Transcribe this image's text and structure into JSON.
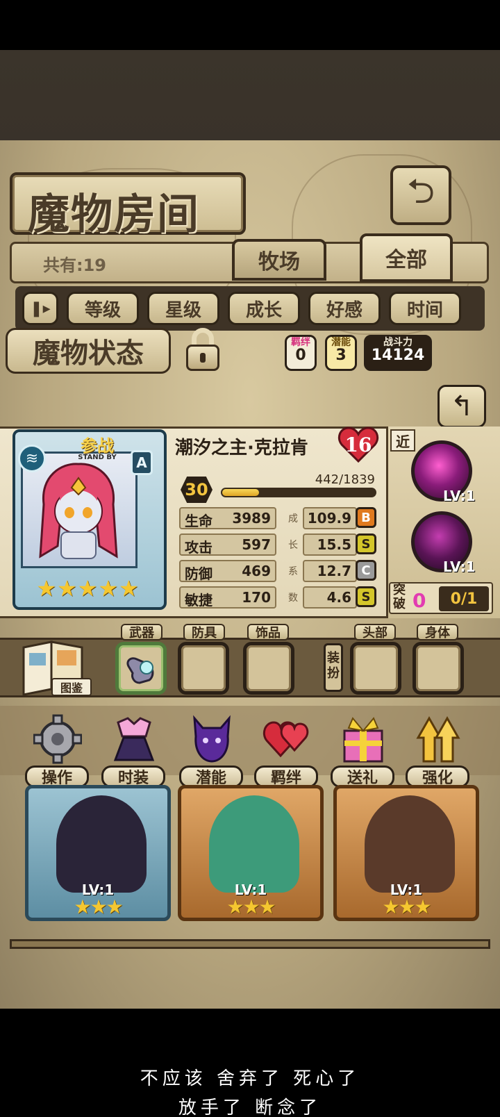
{
  "screen": {
    "title": "魔物房间",
    "total_label": "共有:19",
    "tabs": [
      {
        "label": "牧场"
      },
      {
        "label": "全部"
      }
    ],
    "sort_buttons": [
      "等级",
      "星级",
      "成长",
      "好感",
      "时间"
    ]
  },
  "status": {
    "title": "魔物状态",
    "bond": {
      "label": "羁绊",
      "value": "0"
    },
    "potential": {
      "label": "潜能",
      "value": "3"
    },
    "power": {
      "label": "战斗力",
      "value": "14124"
    }
  },
  "monster": {
    "standby_cn": "参战",
    "standby_en": "STAND BY",
    "rank": "A",
    "name": "潮汐之主·克拉肯",
    "affection": "16",
    "level": "30",
    "exp_text": "442/1839",
    "exp_ratio": 0.24,
    "star_count": 5,
    "stats": [
      {
        "label": "生命",
        "value": "3989",
        "growth": "109.9",
        "grade": "B",
        "side": "成"
      },
      {
        "label": "攻击",
        "value": "597",
        "growth": "15.5",
        "grade": "S",
        "side": "长"
      },
      {
        "label": "防御",
        "value": "469",
        "growth": "12.7",
        "grade": "C",
        "side": "系"
      },
      {
        "label": "敏捷",
        "value": "170",
        "growth": "4.6",
        "grade": "S",
        "side": "数"
      }
    ],
    "range_tag": "近",
    "skills": [
      {
        "lv": "LV:1"
      },
      {
        "lv": "LV:1"
      }
    ],
    "breakthrough": {
      "label": "突破",
      "count": "0",
      "progress": "0/1"
    }
  },
  "equipment": {
    "codex_label": "图鉴",
    "dress_label": "装扮",
    "slots": [
      "武器",
      "防具",
      "饰品",
      "头部",
      "身体"
    ]
  },
  "actions": [
    "操作",
    "时装",
    "潜能",
    "羁绊",
    "送礼",
    "强化"
  ],
  "roster": [
    {
      "lv": "LV:1",
      "stars": "★★★"
    },
    {
      "lv": "LV:1",
      "stars": "★★★"
    },
    {
      "lv": "LV:1",
      "stars": "★★★"
    }
  ],
  "subtitles": {
    "line1": "不应该 舍弃了 死心了",
    "line2": "放手了 断念了"
  },
  "colors": {
    "grade_B": "#e07a1e",
    "grade_S": "#d4c62a",
    "grade_C": "#9a9a9a",
    "accent_pink": "#e23bb1"
  }
}
